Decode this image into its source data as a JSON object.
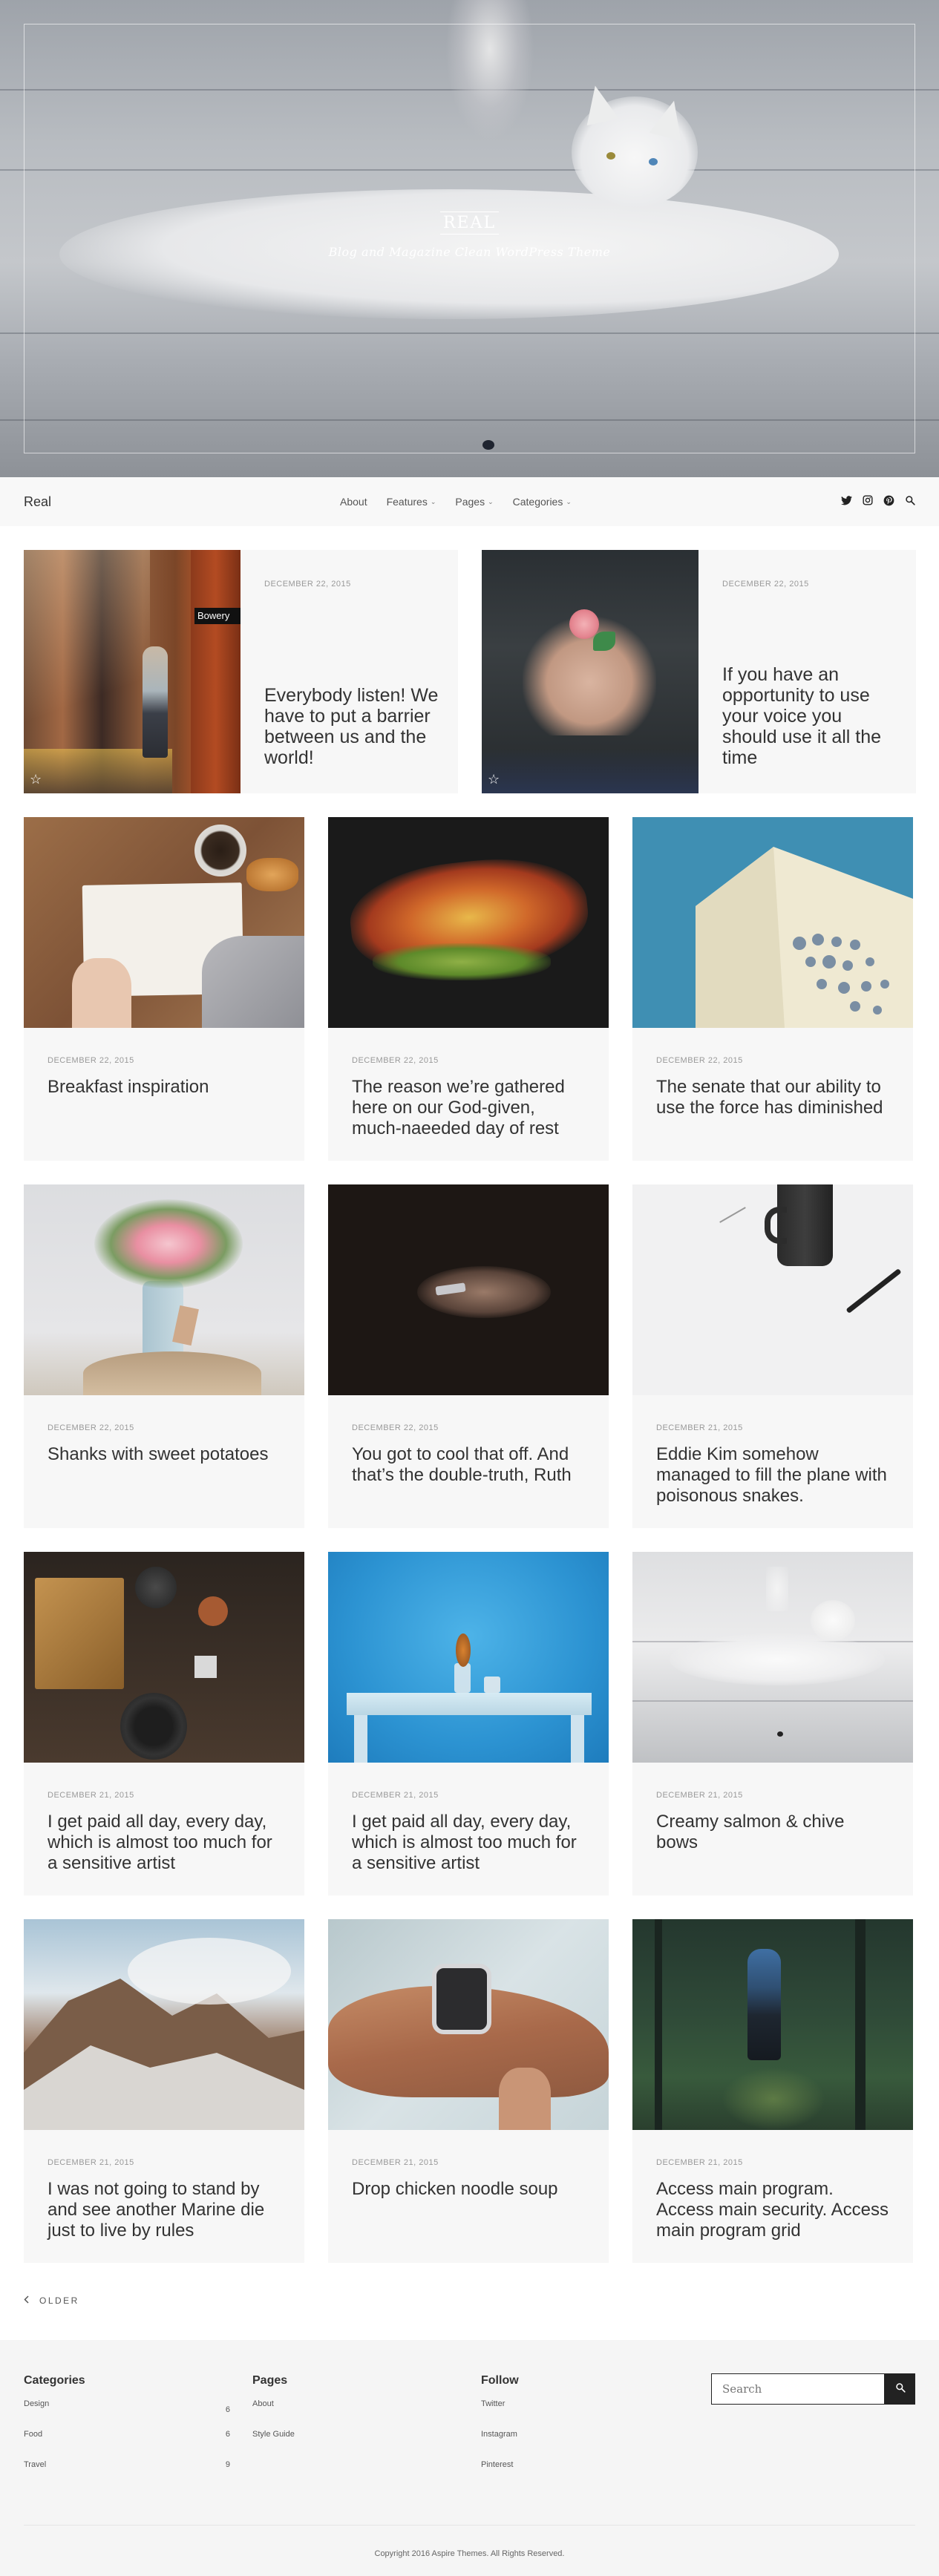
{
  "hero": {
    "site_title": "REAL",
    "tagline": "Blog and Magazine Clean WordPress Theme"
  },
  "nav": {
    "brand": "Real",
    "menu": [
      {
        "label": "About",
        "has_dropdown": false
      },
      {
        "label": "Features",
        "has_dropdown": true
      },
      {
        "label": "Pages",
        "has_dropdown": true
      },
      {
        "label": "Categories",
        "has_dropdown": true
      }
    ],
    "social_icons": [
      "twitter-icon",
      "instagram-icon",
      "pinterest-icon",
      "search-icon"
    ]
  },
  "featured": [
    {
      "date": "DECEMBER 22, 2015",
      "title": "Everybody listen! We have to put a barrier between us and the world!",
      "image": "subway-station-photo"
    },
    {
      "date": "DECEMBER 22, 2015",
      "title": "If you have an opportunity to use your voice you should use it all the time",
      "image": "hands-holding-rose-photo"
    }
  ],
  "posts": [
    {
      "date": "DECEMBER 22, 2015",
      "title": "Breakfast inspiration",
      "image": "notebook-coffee-photo"
    },
    {
      "date": "DECEMBER 22, 2015",
      "title": "The reason we’re gathered here on our God-given, much-naeeded day of rest",
      "image": "autumn-leaves-photo"
    },
    {
      "date": "DECEMBER 22, 2015",
      "title": "The senate that our ability to use the force has diminished",
      "image": "white-building-photo"
    },
    {
      "date": "DECEMBER 22, 2015",
      "title": "Shanks with sweet potatoes",
      "image": "flower-vase-photo"
    },
    {
      "date": "DECEMBER 22, 2015",
      "title": "You got to cool that off. And that’s the double-truth, Ruth",
      "image": "hands-phone-dark-photo"
    },
    {
      "date": "DECEMBER 21, 2015",
      "title": "Eddie Kim somehow managed to fill the plane with poisonous snakes.",
      "image": "coffee-mug-pen-photo"
    },
    {
      "date": "DECEMBER 21, 2015",
      "title": "I get paid all day, every day, which is almost too much for a sensitive artist",
      "image": "kitchen-table-photo"
    },
    {
      "date": "DECEMBER 21, 2015",
      "title": "I get paid all day, every day, which is almost too much for a sensitive artist",
      "image": "blue-wall-table-photo"
    },
    {
      "date": "DECEMBER 21, 2015",
      "title": "Creamy salmon & chive bows",
      "image": "white-cat-photo"
    },
    {
      "date": "DECEMBER 21, 2015",
      "title": "I was not going to stand by and see another Marine die just to live by rules",
      "image": "mountains-photo"
    },
    {
      "date": "DECEMBER 21, 2015",
      "title": "Drop chicken noodle soup",
      "image": "smartwatch-photo"
    },
    {
      "date": "DECEMBER 21, 2015",
      "title": "Access main program. Access main security. Access main program grid",
      "image": "forest-hiker-photo"
    }
  ],
  "pagination": {
    "older_label": "OLDER"
  },
  "footer": {
    "categories": {
      "heading": "Categories",
      "items": [
        {
          "label": "Design",
          "count": "6"
        },
        {
          "label": "Food",
          "count": "6"
        },
        {
          "label": "Travel",
          "count": "9"
        }
      ]
    },
    "pages": {
      "heading": "Pages",
      "items": [
        "About",
        "Style Guide"
      ]
    },
    "follow": {
      "heading": "Follow",
      "items": [
        "Twitter",
        "Instagram",
        "Pinterest"
      ]
    },
    "search": {
      "placeholder": "Search"
    },
    "copyright": "Copyright 2016 Aspire Themes. All Rights Reserved."
  }
}
